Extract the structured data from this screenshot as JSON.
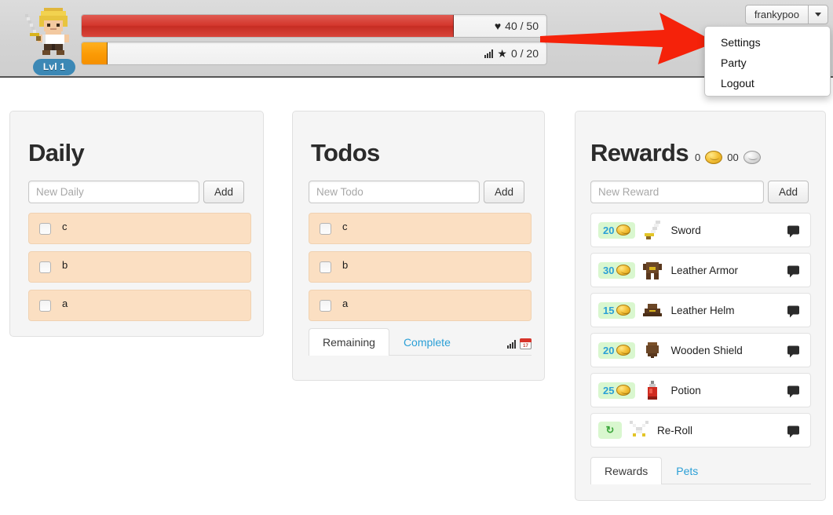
{
  "header": {
    "level_badge": "Lvl 1",
    "avatar_name": "warrior-avatar",
    "health": {
      "icon": "heart-icon",
      "glyph": "♥",
      "value": "40 / 50",
      "current": 40,
      "max": 50
    },
    "experience": {
      "icon": "star-icon",
      "glyph": "★",
      "value": "0 / 20",
      "current": 0,
      "max": 20
    },
    "user": {
      "name": "frankypoo",
      "caret_icon": "chevron-down-icon"
    }
  },
  "dropdown": {
    "items": [
      {
        "label": "Settings"
      },
      {
        "label": "Party"
      },
      {
        "label": "Logout"
      }
    ]
  },
  "annotation": {
    "arrow_color": "#F5220A",
    "points_to": "Settings"
  },
  "daily": {
    "title": "Daily",
    "input_placeholder": "New Daily",
    "input_value": "",
    "add_label": "Add",
    "tasks": [
      {
        "text": "c",
        "checked": false
      },
      {
        "text": "b",
        "checked": false
      },
      {
        "text": "a",
        "checked": false
      }
    ]
  },
  "todos": {
    "title": "Todos",
    "input_placeholder": "New Todo",
    "input_value": "",
    "add_label": "Add",
    "tasks": [
      {
        "text": "c",
        "checked": false
      },
      {
        "text": "b",
        "checked": false
      },
      {
        "text": "a",
        "checked": false
      }
    ],
    "tabs": [
      {
        "label": "Remaining",
        "active": true
      },
      {
        "label": "Complete",
        "active": false
      }
    ],
    "icons": [
      "bar-chart-icon",
      "calendar-icon"
    ],
    "calendar_day": "17"
  },
  "rewards": {
    "title": "Rewards",
    "gold": "0",
    "silver": "00",
    "input_placeholder": "New Reward",
    "input_value": "",
    "add_label": "Add",
    "items": [
      {
        "price": "20",
        "name": "Sword",
        "sprite": "sword-icon",
        "type": "coin"
      },
      {
        "price": "30",
        "name": "Leather Armor",
        "sprite": "armor-icon",
        "type": "coin"
      },
      {
        "price": "15",
        "name": "Leather Helm",
        "sprite": "helm-icon",
        "type": "coin"
      },
      {
        "price": "20",
        "name": "Wooden Shield",
        "sprite": "shield-icon",
        "type": "coin"
      },
      {
        "price": "25",
        "name": "Potion",
        "sprite": "potion-icon",
        "type": "coin"
      },
      {
        "price": "↻",
        "name": "Re-Roll",
        "sprite": "crossed-swords-icon",
        "type": "reroll"
      }
    ],
    "tabs": [
      {
        "label": "Rewards",
        "active": true
      },
      {
        "label": "Pets",
        "active": false
      }
    ]
  },
  "colors": {
    "health_bar": "#d4362c",
    "xp_bar": "#fb9a05",
    "accent_link": "#2a9fd6",
    "task_bg": "#fbdfc2",
    "price_pill": "#d9f7cf",
    "level_badge": "#3c88b5",
    "header_bg": "#d3d3d3"
  }
}
